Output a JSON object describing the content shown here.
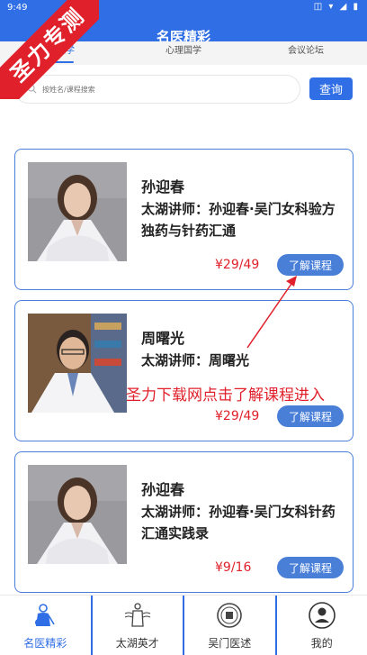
{
  "status_bar": {
    "time": "9:49",
    "icons": "◫ ▾ ◢ ▮"
  },
  "header": {
    "title": "名医精彩"
  },
  "watermark": {
    "ribbon_text": "圣力专测"
  },
  "tabs": [
    {
      "label": "中医学",
      "active": true
    },
    {
      "label": "心理国学",
      "active": false
    },
    {
      "label": "会议论坛",
      "active": false
    }
  ],
  "search": {
    "placeholder": "按姓名/课程搜索",
    "button_label": "查询"
  },
  "courses": [
    {
      "teacher": "孙迎春",
      "description": "太湖讲师：孙迎春·吴门女科验方独药与针药汇通",
      "price": "¥29/49",
      "button": "了解课程"
    },
    {
      "teacher": "周曙光",
      "description": "太湖讲师：周曙光",
      "price": "¥29/49",
      "button": "了解课程"
    },
    {
      "teacher": "孙迎春",
      "description": "太湖讲师：孙迎春·吴门女科针药汇通实践录",
      "price": "¥9/16",
      "button": "了解课程"
    }
  ],
  "annotation": {
    "text": "圣力下载网点击了解课程进入"
  },
  "bottom_nav": [
    {
      "label": "名医精彩",
      "icon": "doctor-icon",
      "active": true
    },
    {
      "label": "太湖英才",
      "icon": "figure-icon",
      "active": false
    },
    {
      "label": "吴门医述",
      "icon": "seal-icon",
      "active": false
    },
    {
      "label": "我的",
      "icon": "user-icon",
      "active": false
    }
  ],
  "colors": {
    "primary": "#2f6ee5",
    "card_border": "#4a7fd8",
    "price": "#e0202a",
    "ribbon": "#e0202a"
  }
}
